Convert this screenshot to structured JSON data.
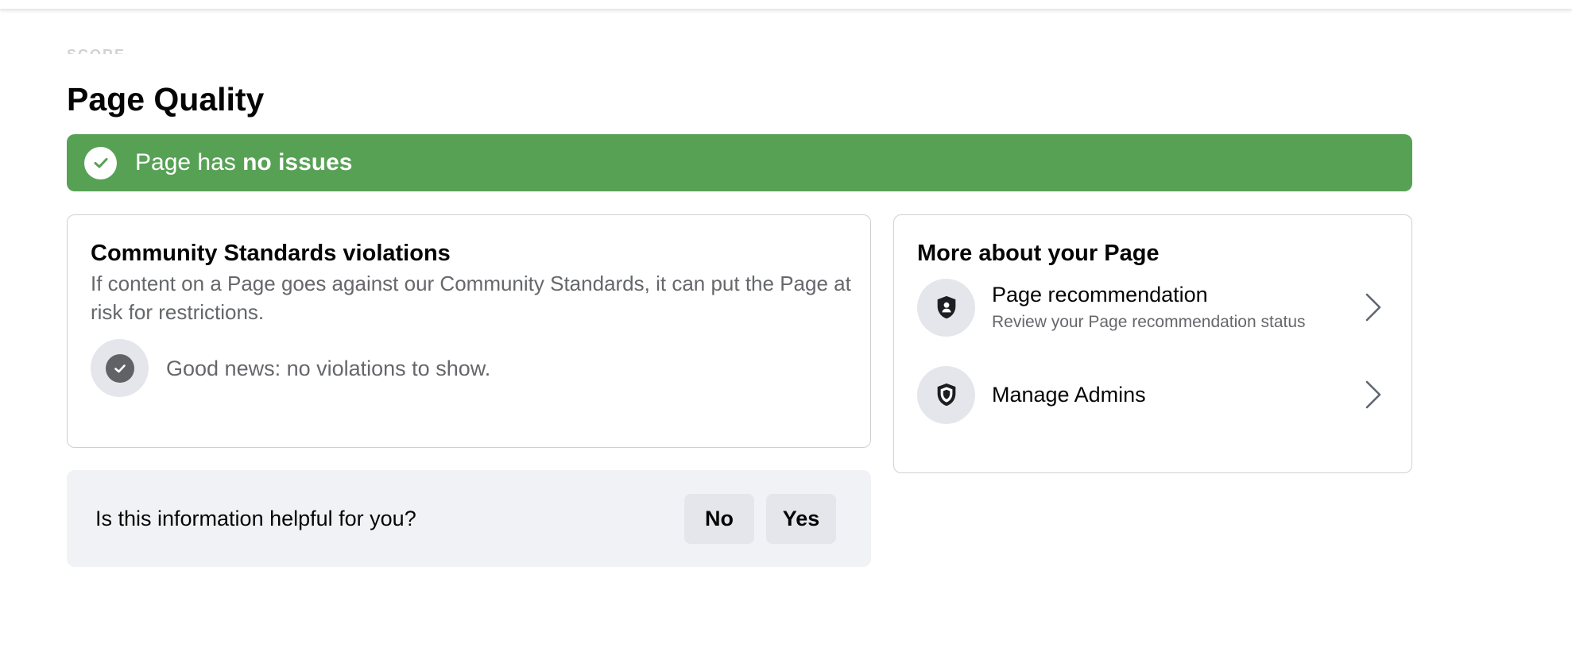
{
  "header": {
    "faded_label": "SCORE",
    "page_title": "Page Quality"
  },
  "status": {
    "prefix": "Page has ",
    "emphasis": "no issues",
    "color": "#57a155",
    "icon": "check-circle-icon"
  },
  "violations": {
    "title": "Community Standards violations",
    "description": "If content on a Page goes against our Community Standards, it can put the Page at risk for restrictions.",
    "empty_text": "Good news: no violations to show.",
    "icon": "check-circle-icon"
  },
  "more": {
    "title": "More about your Page",
    "items": [
      {
        "title": "Page recommendation",
        "subtitle": "Review your Page recommendation status",
        "icon": "shield-person-icon"
      },
      {
        "title": "Manage Admins",
        "subtitle": "",
        "icon": "shield-icon"
      }
    ]
  },
  "feedback": {
    "question": "Is this information helpful for you?",
    "no_label": "No",
    "yes_label": "Yes"
  }
}
